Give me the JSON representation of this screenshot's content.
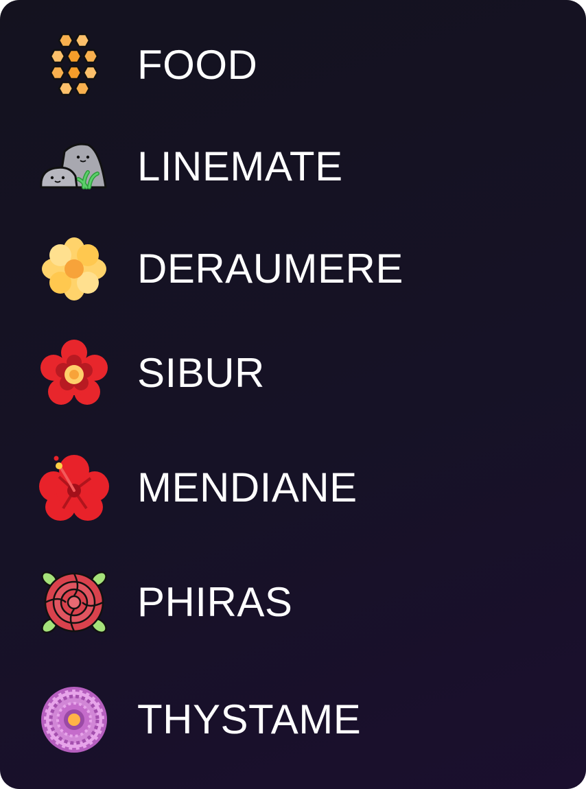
{
  "resources": [
    {
      "label": "FOOD",
      "icon": "honeycomb-icon"
    },
    {
      "label": "LINEMATE",
      "icon": "rocks-icon"
    },
    {
      "label": "DERAUMERE",
      "icon": "yellow-flower-icon"
    },
    {
      "label": "SIBUR",
      "icon": "red-flower-icon"
    },
    {
      "label": "MENDIANE",
      "icon": "hibiscus-icon"
    },
    {
      "label": "PHIRAS",
      "icon": "rose-icon"
    },
    {
      "label": "THYSTAME",
      "icon": "purple-chrysanthemum-icon"
    }
  ],
  "colors": {
    "background": "#14121f",
    "text": "#ffffff",
    "honey": "#f59e2a",
    "rock": "#9d9da6",
    "yellow_petal": "#ffd36b",
    "red_petal": "#e8222a",
    "rose": "#d9424d",
    "leaf": "#a5e27a",
    "purple_petal": "#d186d6"
  }
}
